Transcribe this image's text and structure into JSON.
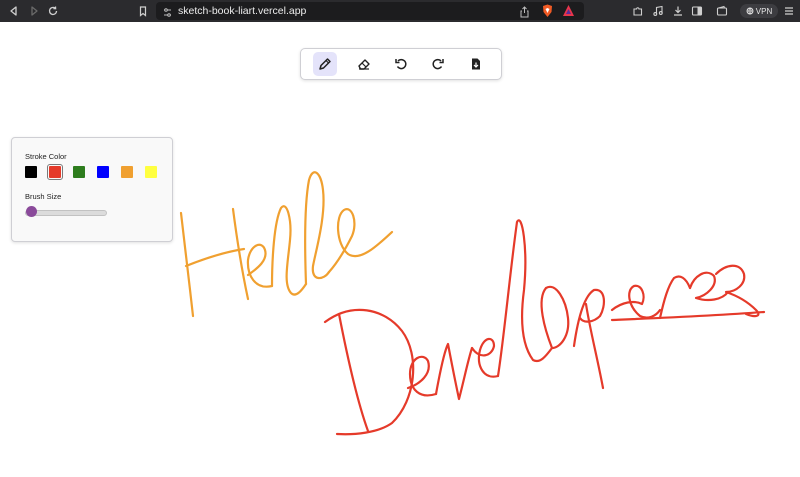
{
  "browser": {
    "url": "sketch-book-liart.vercel.app",
    "vpn_label": "VPN",
    "icons": [
      "back-icon",
      "forward-icon",
      "reload-icon",
      "bookmark-icon",
      "site-settings-icon",
      "share-icon",
      "brave-shield-icon",
      "brave-rewards-icon",
      "extensions-icon",
      "media-icon",
      "download-icon",
      "sidebar-icon",
      "menu-icon"
    ]
  },
  "toolbar": {
    "tools": [
      {
        "name": "pencil-icon",
        "active": true
      },
      {
        "name": "eraser-icon",
        "active": false
      },
      {
        "name": "undo-icon",
        "active": false
      },
      {
        "name": "redo-icon",
        "active": false
      },
      {
        "name": "download-icon",
        "active": false
      }
    ],
    "active_color": "#e4e3fa"
  },
  "settings": {
    "stroke_color_label": "Stroke Color",
    "colors": [
      "#000000",
      "#e53a2a",
      "#2e7d1e",
      "#0000ff",
      "#f0a030",
      "#ffff40"
    ],
    "selected_color": "#e53a2a",
    "brush_size_label": "Brush Size",
    "brush_size_fraction": 0.02,
    "slider_color": "#8a4a9a"
  },
  "canvas": {
    "stroke_colors": {
      "hello": "#f0a030",
      "developers": "#e53a2a"
    }
  }
}
